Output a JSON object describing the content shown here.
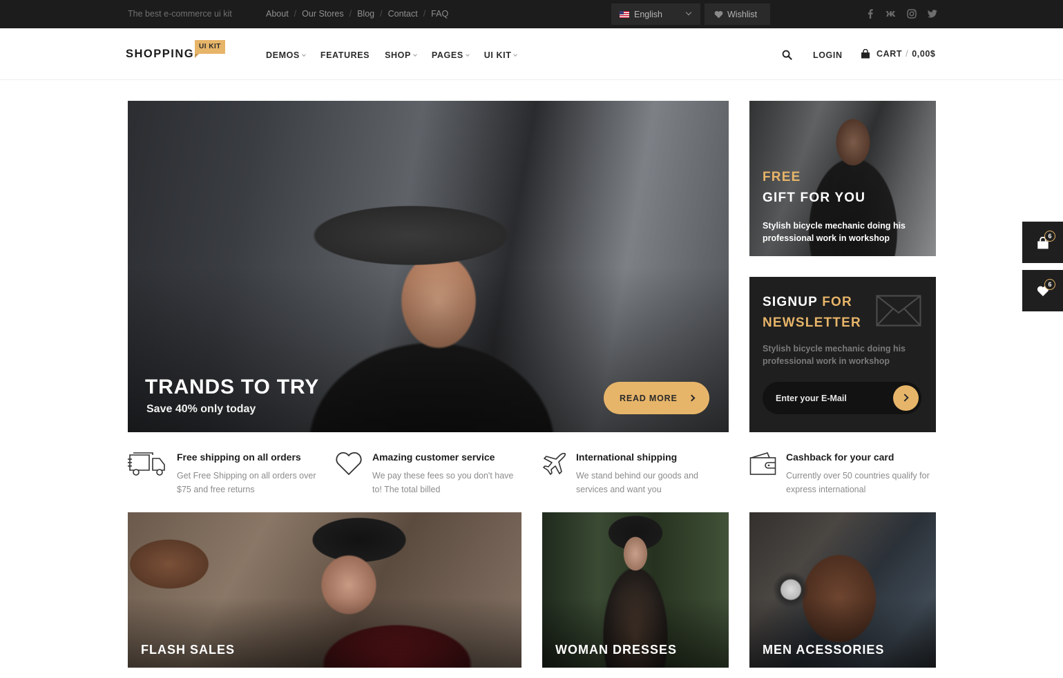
{
  "topbar": {
    "tagline": "The best e-commerce ui kit",
    "links": [
      "About",
      "Our Stores",
      "Blog",
      "Contact",
      "FAQ"
    ],
    "separator": "/",
    "language": "English",
    "wishlist": "Wishlist",
    "social_icons": [
      "facebook-icon",
      "vk-icon",
      "instagram-icon",
      "twitter-icon"
    ]
  },
  "header": {
    "logo": "SHOPPING",
    "logo_badge": "UI KIT",
    "nav": [
      {
        "label": "DEMOS",
        "dropdown": true
      },
      {
        "label": "FEATURES",
        "dropdown": false
      },
      {
        "label": "SHOP",
        "dropdown": true
      },
      {
        "label": "PAGES",
        "dropdown": true
      },
      {
        "label": "UI KIT",
        "dropdown": true
      }
    ],
    "login": "LOGIN",
    "cart_label": "CART",
    "cart_sep": "/",
    "cart_total": "0,00$"
  },
  "hero": {
    "title": "TRANDS TO TRY",
    "subtitle": "Save 40% only today",
    "button": "READ MORE"
  },
  "gift": {
    "accent": "FREE",
    "title": "GIFT FOR YOU",
    "text": "Stylish bicycle mechanic doing his professional work in workshop"
  },
  "newsletter": {
    "title_white": "SIGNUP",
    "title_accent_1": "FOR",
    "title_accent_2": "NEWSLETTER",
    "text": "Stylish bicycle mechanic doing his professional work in workshop",
    "input_placeholder": "Enter your E-Mail"
  },
  "side_buttons": {
    "cart_count": "6",
    "wishlist_count": "6"
  },
  "features": [
    {
      "icon": "truck-icon",
      "title": "Free shipping on all orders",
      "desc": "Get Free Shipping on all orders over $75 and free returns"
    },
    {
      "icon": "heart-icon",
      "title": "Amazing customer service",
      "desc": "We pay these fees so you don't have to! The total billed"
    },
    {
      "icon": "airplane-icon",
      "title": "International shipping",
      "desc": "We stand behind our goods and services and want you"
    },
    {
      "icon": "wallet-icon",
      "title": "Cashback for your card",
      "desc": "Currently over 50 countries qualify for express international"
    }
  ],
  "categories": [
    {
      "title": "FLASH SALES"
    },
    {
      "title": "WOMAN DRESSES"
    },
    {
      "title": "MEN ACESSORIES"
    }
  ],
  "colors": {
    "accent": "#e7b569",
    "topbar_bg": "#1c1c1c",
    "dark_panel": "#1f1f1f"
  }
}
